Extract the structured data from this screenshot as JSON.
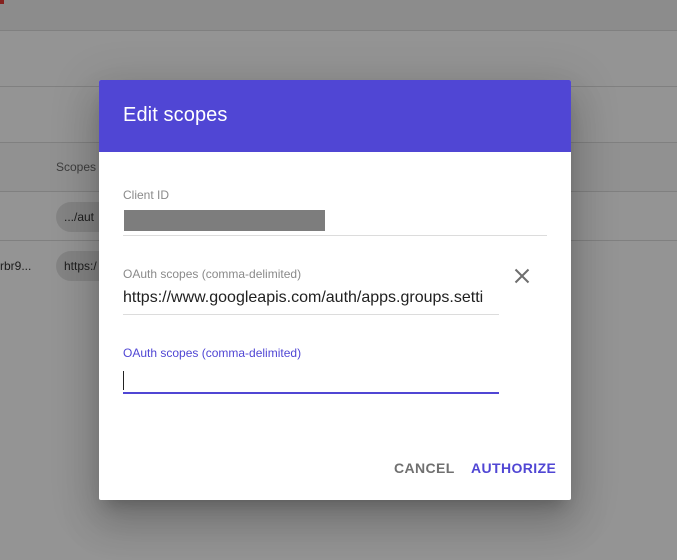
{
  "background": {
    "table_header": "Scopes",
    "rows": [
      {
        "id_fragment": "",
        "scope_chip": ".../aut"
      },
      {
        "id_fragment": "rbr9...",
        "scope_chip": "https:/"
      }
    ]
  },
  "dialog": {
    "title": "Edit scopes",
    "client_id_label": "Client ID",
    "client_id_value_redacted": true,
    "scope_fields": [
      {
        "label": "OAuth scopes (comma-delimited)",
        "value": "https://www.googleapis.com/auth/apps.groups.setti",
        "remove_icon": "close-icon"
      },
      {
        "label": "OAuth scopes (comma-delimited)",
        "value": "",
        "focused": true
      }
    ],
    "actions": {
      "cancel_label": "CANCEL",
      "authorize_label": "AUTHORIZE"
    }
  },
  "colors": {
    "accent": "#5046d4",
    "scrim": "rgba(0,0,0,0.42)",
    "muted_text": "#8a8a8a"
  }
}
